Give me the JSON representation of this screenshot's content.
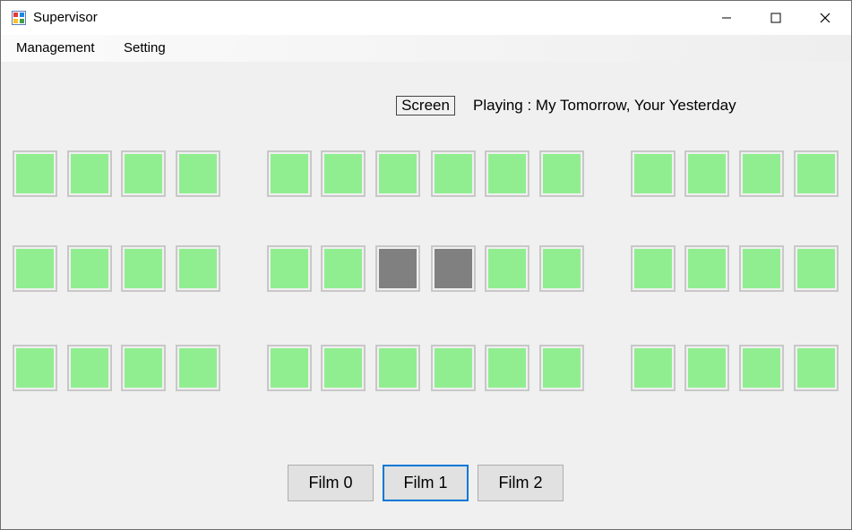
{
  "window": {
    "title": "Supervisor"
  },
  "menu": {
    "items": [
      "Management",
      "Setting"
    ]
  },
  "screen_label": "Screen",
  "playing_text": "Playing : My Tomorrow, Your Yesterday",
  "seats": {
    "colors": {
      "available": "#90ee90",
      "occupied": "#808080"
    },
    "rows": [
      [
        "available",
        "available",
        "available",
        "available",
        "available",
        "available",
        "available",
        "available",
        "available",
        "available",
        "available",
        "available",
        "available",
        "available"
      ],
      [
        "available",
        "available",
        "available",
        "available",
        "available",
        "available",
        "occupied",
        "occupied",
        "available",
        "available",
        "available",
        "available",
        "available",
        "available"
      ],
      [
        "available",
        "available",
        "available",
        "available",
        "available",
        "available",
        "available",
        "available",
        "available",
        "available",
        "available",
        "available",
        "available",
        "available"
      ]
    ]
  },
  "films": [
    {
      "label": "Film 0"
    },
    {
      "label": "Film 1",
      "focused": true
    },
    {
      "label": "Film 2"
    }
  ]
}
